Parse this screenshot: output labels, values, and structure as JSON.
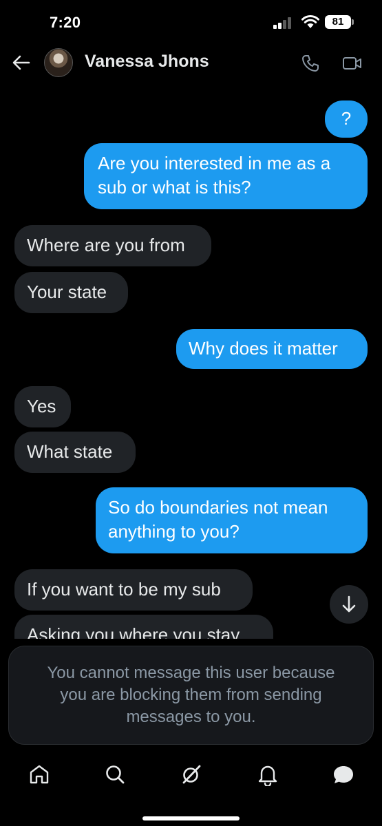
{
  "status_bar": {
    "time": "7:20",
    "battery": "81"
  },
  "header": {
    "contact_name": "Vanessa Jhons"
  },
  "messages": [
    {
      "direction": "outgoing",
      "lines": [
        "?"
      ]
    },
    {
      "direction": "outgoing",
      "lines": [
        "Are you interested in me as a",
        "sub or what is this?"
      ]
    },
    {
      "direction": "incoming",
      "lines": [
        "Where are you from"
      ]
    },
    {
      "direction": "incoming",
      "lines": [
        "Your state"
      ]
    },
    {
      "direction": "outgoing",
      "lines": [
        "Why does it matter"
      ]
    },
    {
      "direction": "incoming",
      "lines": [
        "Yes"
      ]
    },
    {
      "direction": "incoming",
      "lines": [
        "What state"
      ]
    },
    {
      "direction": "outgoing",
      "lines": [
        "So do boundaries not mean",
        "anything to you?"
      ]
    },
    {
      "direction": "incoming",
      "lines": [
        "If you want to be my sub"
      ]
    },
    {
      "direction": "incoming",
      "lines": [
        "Asking you where you stay"
      ]
    }
  ],
  "blocked_notice": {
    "lines": [
      "You cannot message this user because",
      "you are blocking them from sending",
      "messages to you."
    ]
  },
  "colors": {
    "background": "#000000",
    "outgoing_bubble": "#1d9bf0",
    "incoming_bubble": "#202327",
    "notice_text": "#8b98a5"
  },
  "icons": {
    "header": [
      "back-arrow-icon",
      "phone-icon",
      "video-call-icon"
    ],
    "bottom_nav": [
      "home-icon",
      "search-icon",
      "grok-icon",
      "notifications-bell-icon",
      "messages-icon"
    ],
    "scroll": "arrow-down-icon"
  }
}
